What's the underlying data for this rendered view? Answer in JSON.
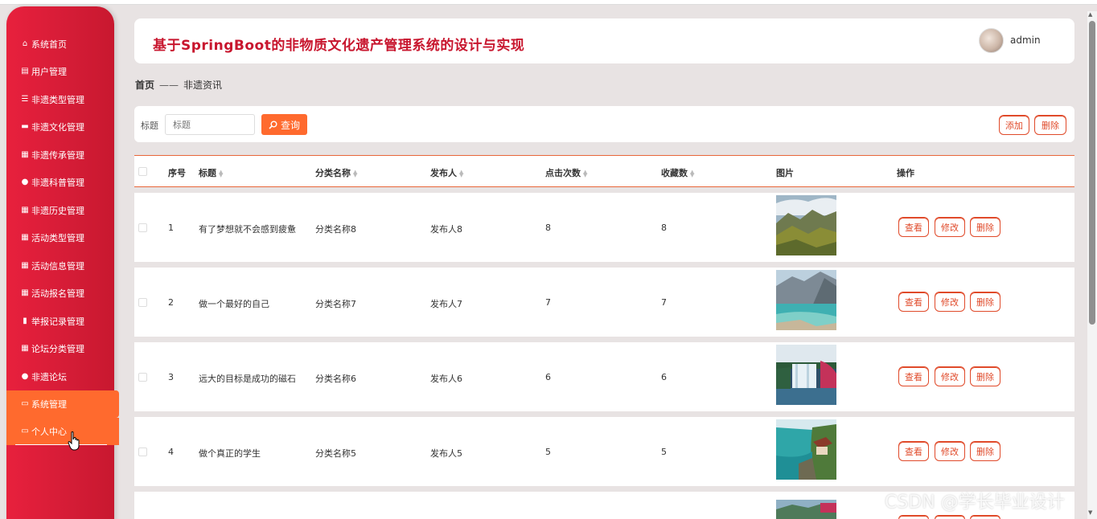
{
  "sidebar": {
    "items": [
      {
        "label": "系统首页",
        "icon": "home-icon",
        "glyph": "⌂"
      },
      {
        "label": "用户管理",
        "icon": "clipboard-icon",
        "glyph": "▤"
      },
      {
        "label": "非遗类型管理",
        "icon": "sliders-icon",
        "glyph": "☰"
      },
      {
        "label": "非遗文化管理",
        "icon": "ticket-icon",
        "glyph": "▬"
      },
      {
        "label": "非遗传承管理",
        "icon": "grid-icon",
        "glyph": "▦"
      },
      {
        "label": "非遗科普管理",
        "icon": "person-icon",
        "glyph": "●"
      },
      {
        "label": "非遗历史管理",
        "icon": "grid-icon",
        "glyph": "▦"
      },
      {
        "label": "活动类型管理",
        "icon": "grid-icon",
        "glyph": "▦"
      },
      {
        "label": "活动信息管理",
        "icon": "grid-icon",
        "glyph": "▦"
      },
      {
        "label": "活动报名管理",
        "icon": "grid-icon",
        "glyph": "▦"
      },
      {
        "label": "举报记录管理",
        "icon": "report-icon",
        "glyph": "▮"
      },
      {
        "label": "论坛分类管理",
        "icon": "grid-icon",
        "glyph": "▦"
      },
      {
        "label": "非遗论坛",
        "icon": "location-pin-icon",
        "glyph": "●"
      },
      {
        "label": "系统管理",
        "icon": "monitor-icon",
        "glyph": "▭"
      },
      {
        "label": "个人中心",
        "icon": "id-card-icon",
        "glyph": "▭"
      }
    ]
  },
  "header": {
    "title": "基于SpringBoot的非物质文化遗产管理系统的设计与实现",
    "username": "admin"
  },
  "breadcrumb": {
    "home": "首页",
    "separator": "——",
    "current": "非遗资讯"
  },
  "search": {
    "label": "标题",
    "placeholder": "标题",
    "query_button": "查询",
    "add_button": "添加",
    "delete_button": "删除"
  },
  "table": {
    "columns": [
      "序号",
      "标题",
      "分类名称",
      "发布人",
      "点击次数",
      "收藏数",
      "图片",
      "操作"
    ],
    "rows": [
      {
        "index": "1",
        "title": "有了梦想就不会感到疲惫",
        "category": "分类名称8",
        "publisher": "发布人8",
        "clicks": "8",
        "favorites": "8",
        "image": "mountain-valley"
      },
      {
        "index": "2",
        "title": "做一个最好的自己",
        "category": "分类名称7",
        "publisher": "发布人7",
        "clicks": "7",
        "favorites": "7",
        "image": "turquoise-lake"
      },
      {
        "index": "3",
        "title": "远大的目标是成功的磁石",
        "category": "分类名称6",
        "publisher": "发布人6",
        "clicks": "6",
        "favorites": "6",
        "image": "waterfall"
      },
      {
        "index": "4",
        "title": "做个真正的学生",
        "category": "分类名称5",
        "publisher": "发布人5",
        "clicks": "5",
        "favorites": "5",
        "image": "river-pavilion"
      }
    ],
    "actions": {
      "view": "查看",
      "edit": "修改",
      "delete": "删除"
    }
  },
  "watermark": "CSDN @学长毕业设计",
  "colors": {
    "sidebar": "#d41c36",
    "accent": "#ff6a2e",
    "title": "#c8162e",
    "button_border": "#e04a2a"
  }
}
